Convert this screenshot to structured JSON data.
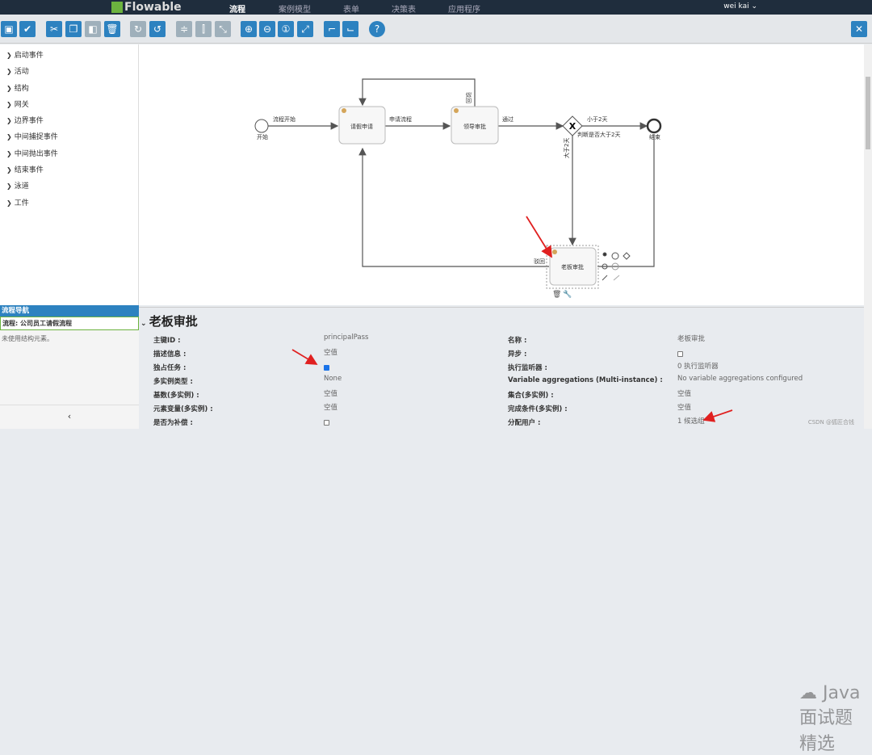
{
  "header": {
    "logo": "Flowable",
    "nav": [
      "流程",
      "案例模型",
      "表单",
      "决策表",
      "应用程序"
    ],
    "active": "流程",
    "user": "wei kai ⌄"
  },
  "toolbar": {
    "icons": [
      "save-icon",
      "validate-icon",
      "cut-icon",
      "copy-icon",
      "paste-icon",
      "delete-icon",
      "redo-icon",
      "undo-icon",
      "align-horizontal-icon",
      "align-vertical-icon",
      "same-size-icon",
      "zoom-in-icon",
      "zoom-out-icon",
      "zoom-actual-icon",
      "zoom-fit-icon",
      "add-bendpoint-icon",
      "remove-bendpoint-icon",
      "help-icon"
    ],
    "close": "✕"
  },
  "palette": [
    "启动事件",
    "活动",
    "结构",
    "网关",
    "边界事件",
    "中间捕捉事件",
    "中间抛出事件",
    "结束事件",
    "泳道",
    "工件"
  ],
  "diagram": {
    "start": "开始",
    "start_flow": "流程开始",
    "task1": "请假申请",
    "flow1": "申请流程",
    "task2": "领导审批",
    "reject1": "驳回",
    "pass": "通过",
    "gateway_label": "判断是否大于2天",
    "less": "小于2天",
    "more": "大于2天",
    "end": "结束",
    "task3": "老板审批",
    "reject2": "驳回"
  },
  "navigator": {
    "title": "流程导航",
    "process": "流程: 公司员工请假流程",
    "note": "未使用结构元素。",
    "collapse": "‹"
  },
  "properties": {
    "title": "老板审批",
    "left": [
      {
        "label": "主键ID :",
        "value": "principalPass"
      },
      {
        "label": "描述信息 :",
        "value": "空值"
      },
      {
        "label": "独占任务 :",
        "checkbox": true
      },
      {
        "label": "多实例类型 :",
        "value": "None"
      },
      {
        "label": "基数(多实例) :",
        "value": "空值"
      },
      {
        "label": "元素变量(多实例) :",
        "value": "空值"
      },
      {
        "label": "是否为补偿 :",
        "checkbox": false
      }
    ],
    "right": [
      {
        "label": "名称 :",
        "value": "老板审批"
      },
      {
        "label": "异步 :",
        "checkbox": false
      },
      {
        "label": "执行监听器 :",
        "value": "0 执行监听器"
      },
      {
        "label": "Variable aggregations (Multi-instance) :",
        "value": "No variable aggregations configured"
      },
      {
        "label": "集合(多实例) :",
        "value": "空值"
      },
      {
        "label": "完成条件(多实例) :",
        "value": "空值"
      },
      {
        "label": "分配用户 :",
        "value": "1 候选组"
      }
    ]
  },
  "watermark": "Java面试题精选",
  "csdn": "CSDN @狐匠合钱",
  "colors": {
    "header": "#1f2d3d",
    "accent": "#2d82c0",
    "logo": "#6cb33f",
    "arrow": "#e02020"
  }
}
